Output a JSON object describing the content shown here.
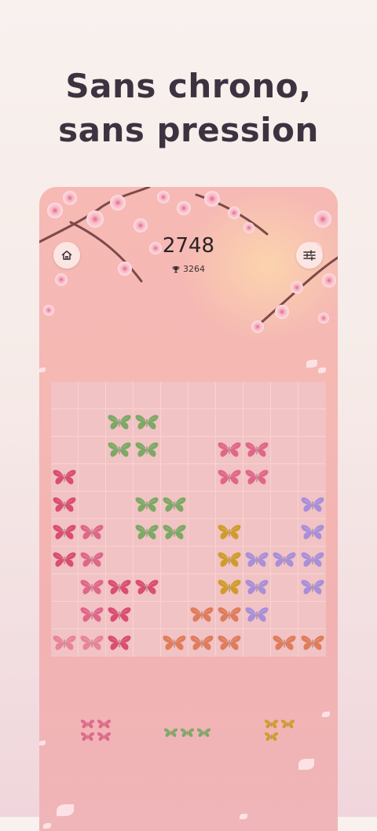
{
  "headline": {
    "line1": "Sans chrono,",
    "line2": "sans pression"
  },
  "game": {
    "score": "2748",
    "best": "3264"
  },
  "icons": {
    "home": "home-icon",
    "settings": "sliders-icon",
    "trophy": "trophy-icon"
  },
  "colors": {
    "green": "#7da865",
    "pink": "#d94e71",
    "rose": "#df6789",
    "light_pink": "#e7849a",
    "gold": "#cf9c2b",
    "lavender": "#a98fd8",
    "orange": "#df7c5c"
  },
  "board": {
    "rows": [
      [
        null,
        null,
        null,
        null,
        null,
        null,
        null,
        null,
        null,
        null
      ],
      [
        null,
        null,
        "green",
        "green",
        null,
        null,
        null,
        null,
        null,
        null
      ],
      [
        null,
        null,
        "green",
        "green",
        null,
        null,
        "rose",
        "rose",
        null,
        null
      ],
      [
        "pink",
        null,
        null,
        null,
        null,
        null,
        "rose",
        "rose",
        null,
        null
      ],
      [
        "pink",
        null,
        null,
        "green",
        "green",
        null,
        null,
        null,
        null,
        "lavender"
      ],
      [
        "pink",
        "rose",
        null,
        "green",
        "green",
        null,
        "gold",
        null,
        null,
        "lavender"
      ],
      [
        "pink",
        "rose",
        null,
        null,
        null,
        null,
        "gold",
        "lavender",
        "lavender",
        "lavender"
      ],
      [
        null,
        "rose",
        "pink",
        "pink",
        null,
        null,
        "gold",
        "lavender",
        null,
        "lavender"
      ],
      [
        null,
        "rose",
        "pink",
        null,
        null,
        "orange",
        "orange",
        "lavender",
        null,
        null
      ],
      [
        "light_pink",
        "light_pink",
        "pink",
        null,
        "orange",
        "orange",
        "orange",
        null,
        "orange",
        "orange"
      ]
    ]
  },
  "pieces": [
    {
      "color": "rose",
      "shape": [
        [
          1,
          1
        ],
        [
          1,
          1
        ]
      ]
    },
    {
      "color": "green",
      "shape": [
        [
          1,
          1,
          1
        ]
      ]
    },
    {
      "color": "gold",
      "shape": [
        [
          1,
          1
        ],
        [
          1,
          0
        ]
      ]
    }
  ]
}
